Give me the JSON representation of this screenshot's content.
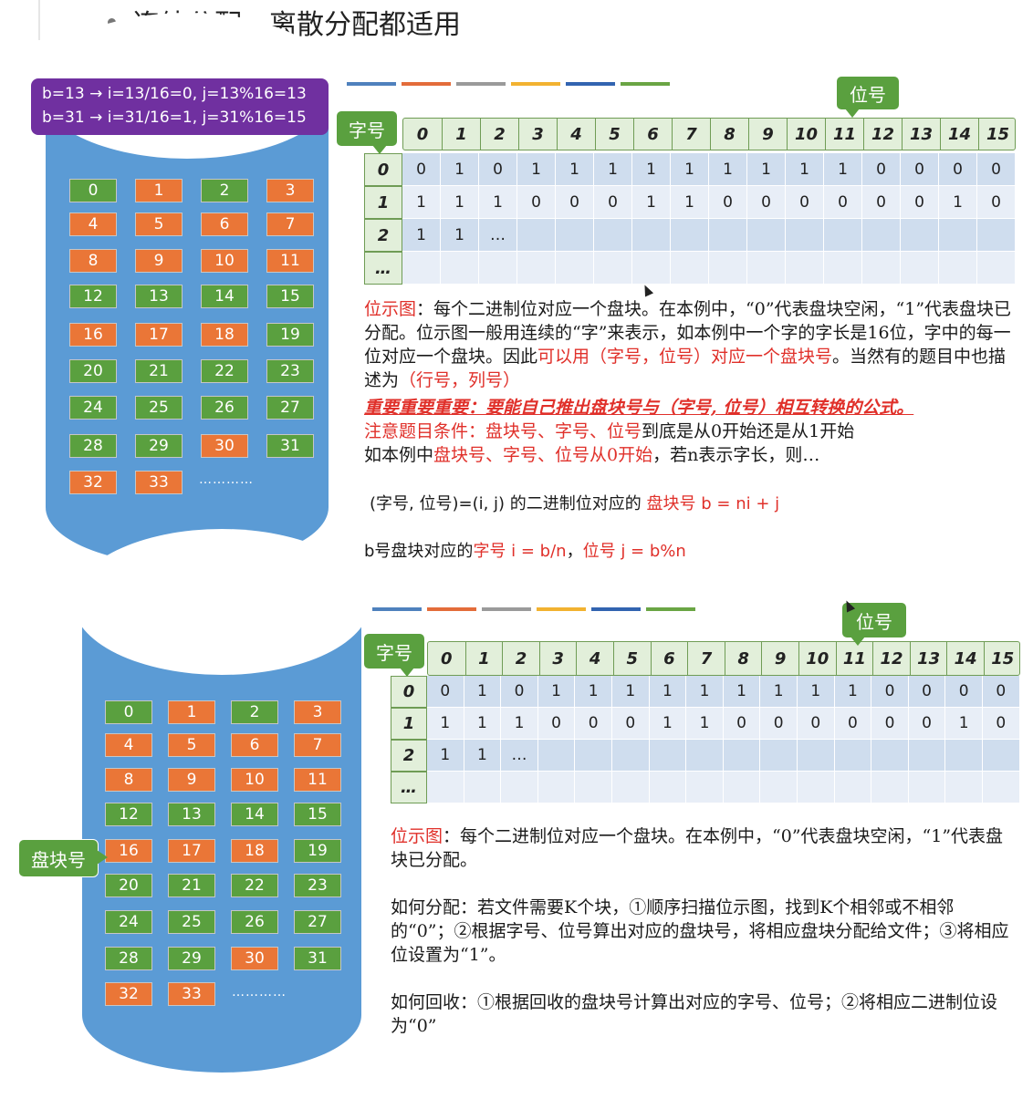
{
  "heading": "连续分配，离散分配都适用",
  "formula": {
    "line1": "b=13 → i=13/16=0, j=13%16=13",
    "line2": "b=31 → i=31/16=1, j=31%16=15"
  },
  "labels": {
    "bit": "位号",
    "word": "字号",
    "block": "盘块号"
  },
  "colors": {
    "green": "#5aa03f",
    "orange": "#ea7637",
    "disk": "#5b9bd5",
    "purple": "#7030a0",
    "red": "#e0302a",
    "strip": [
      "#4f81bd",
      "#e36c3a",
      "#9a9a9a",
      "#f2b230",
      "#3264b0",
      "#6aa544"
    ]
  },
  "blocks": [
    "0",
    "1",
    "2",
    "3",
    "4",
    "5",
    "6",
    "7",
    "8",
    "9",
    "10",
    "11",
    "12",
    "13",
    "14",
    "15",
    "16",
    "17",
    "18",
    "19",
    "20",
    "21",
    "22",
    "23",
    "24",
    "25",
    "26",
    "27",
    "28",
    "29",
    "30",
    "31",
    "32",
    "33"
  ],
  "blocks_more": "…………",
  "bitmap": {
    "col_headers": [
      "0",
      "1",
      "2",
      "3",
      "4",
      "5",
      "6",
      "7",
      "8",
      "9",
      "10",
      "11",
      "12",
      "13",
      "14",
      "15"
    ],
    "row_headers": [
      "0",
      "1",
      "2",
      "…"
    ],
    "rows": [
      [
        "0",
        "1",
        "0",
        "1",
        "1",
        "1",
        "1",
        "1",
        "1",
        "1",
        "1",
        "1",
        "0",
        "0",
        "0",
        "0"
      ],
      [
        "1",
        "1",
        "1",
        "0",
        "0",
        "0",
        "1",
        "1",
        "0",
        "0",
        "0",
        "0",
        "0",
        "0",
        "1",
        "0"
      ],
      [
        "1",
        "1",
        "…",
        "",
        "",
        "",
        "",
        "",
        "",
        "",
        "",
        "",
        "",
        "",
        "",
        ""
      ],
      [
        "",
        "",
        "",
        "",
        "",
        "",
        "",
        "",
        "",
        "",
        "",
        "",
        "",
        "",
        "",
        ""
      ]
    ]
  },
  "text1": {
    "p1_a": "位示图",
    "p1_b": "：每个二进制位对应一个盘块。在本例中，“0”代表盘块空闲，“1”代表盘块已分配。位示图一般用连续的“字”来表示，如本例中一个字的字长是16位，字中的每一位对应一个盘块。因此",
    "p1_c": "可以用（字号，位号）对应一个盘块号",
    "p1_d": "。当然有的题目中也描述为",
    "p1_e": "（行号，列号）",
    "important": "重要重要重要：要能自己推出盘块号与（字号, 位号）相互转换的公式。",
    "note_a": "注意题目条件：盘块号、字号、位号",
    "note_b": "到底是从0开始还是从1开始",
    "ex_a": "如本例中",
    "ex_b": "盘块号、字号、位号从0开始",
    "ex_c": "，若n表示字长，则…",
    "f1_a": "(字号, 位号)=(i, j) 的二进制位对应的 ",
    "f1_b": "盘块号 b = ni + j",
    "f2_a": "b号盘块对应的",
    "f2_b": "字号 i = b/n",
    "f2_c": "，",
    "f2_d": "位号 j = b%n"
  },
  "text2": {
    "p1_a": "位示图",
    "p1_b": "：每个二进制位对应一个盘块。在本例中，“0”代表盘块空闲，“1”代表盘块已分配。",
    "p2": "如何分配：若文件需要K个块，①顺序扫描位示图，找到K个相邻或不相邻的“0”；②根据字号、位号算出对应的盘块号，将相应盘块分配给文件；③将相应位设置为“1”。",
    "p3": "如何回收：①根据回收的盘块号计算出对应的字号、位号；②将相应二进制位设为“0”"
  }
}
